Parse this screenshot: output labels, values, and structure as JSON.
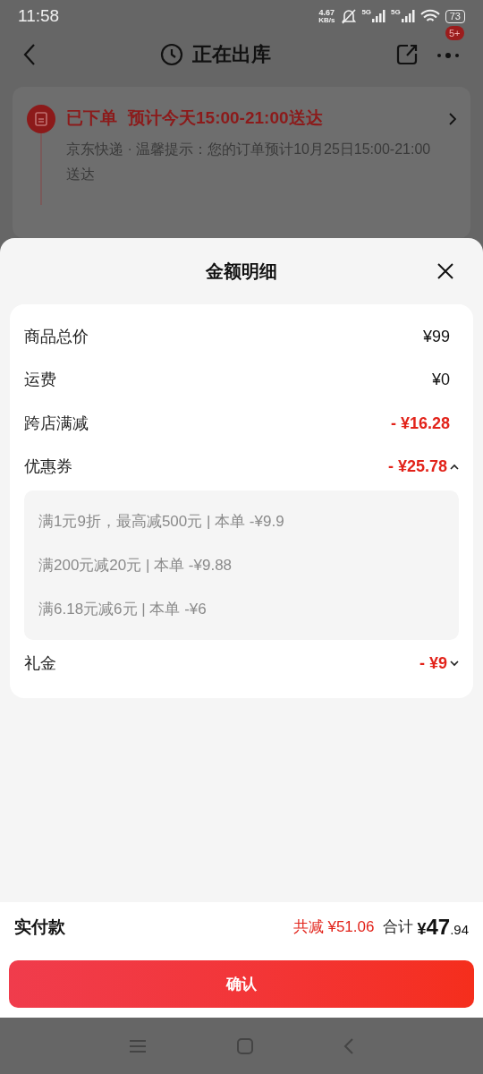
{
  "status_bar": {
    "time": "11:58",
    "net_speed": "4.67",
    "net_unit": "KB/s",
    "signals": [
      "5G",
      "5G"
    ],
    "battery": "73"
  },
  "header": {
    "title": "正在出库",
    "badge": "5+"
  },
  "order_card": {
    "status": "已下单",
    "eta": "预计今天15:00-21:00送达",
    "note": "京东快递 · 温馨提示：您的订单预计10月25日15:00-21:00送达"
  },
  "sheet": {
    "title": "金额明细",
    "rows": [
      {
        "label": "商品总价",
        "value": "¥99",
        "kind": "plain"
      },
      {
        "label": "运费",
        "value": "¥0",
        "kind": "plain"
      },
      {
        "label": "跨店满减",
        "value": "- ¥16.28",
        "kind": "discount"
      },
      {
        "label": "优惠券",
        "value": "- ¥25.78",
        "kind": "discount",
        "expanded": true,
        "details": [
          "满1元9折，最高减500元 | 本单 -¥9.9",
          "满200元减20元 | 本单 -¥9.88",
          "满6.18元减6元 | 本单 -¥6"
        ]
      },
      {
        "label": "礼金",
        "value": "- ¥9",
        "kind": "discount",
        "expanded": false
      }
    ]
  },
  "footer": {
    "label": "实付款",
    "saved_label": "共减",
    "saved": "¥51.06",
    "total_label": "合计",
    "total_currency": "¥",
    "total_int": "47",
    "total_dec": ".94",
    "confirm": "确认"
  }
}
